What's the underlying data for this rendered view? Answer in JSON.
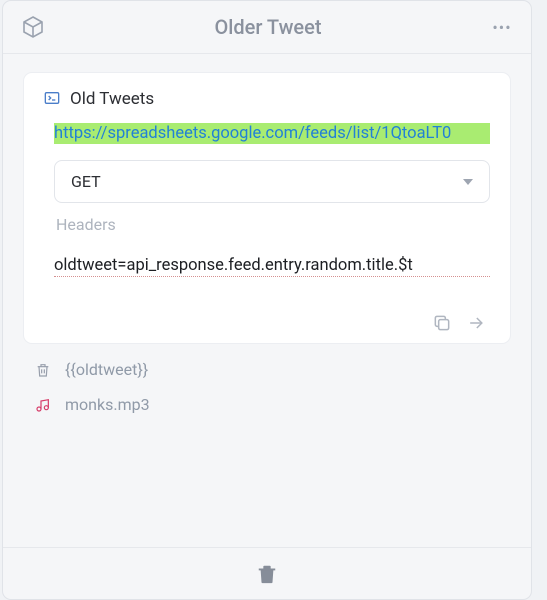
{
  "header": {
    "title": "Older Tweet"
  },
  "card": {
    "title": "Old Tweets",
    "url": "https://spreadsheets.google.com/feeds/list/1QtoaLT0",
    "method": "GET",
    "headers_label": "Headers",
    "code": "oldtweet=api_response.feed.entry.random.title.$t"
  },
  "items": {
    "variable": "{{oldtweet}}",
    "audio": "monks.mp3"
  }
}
